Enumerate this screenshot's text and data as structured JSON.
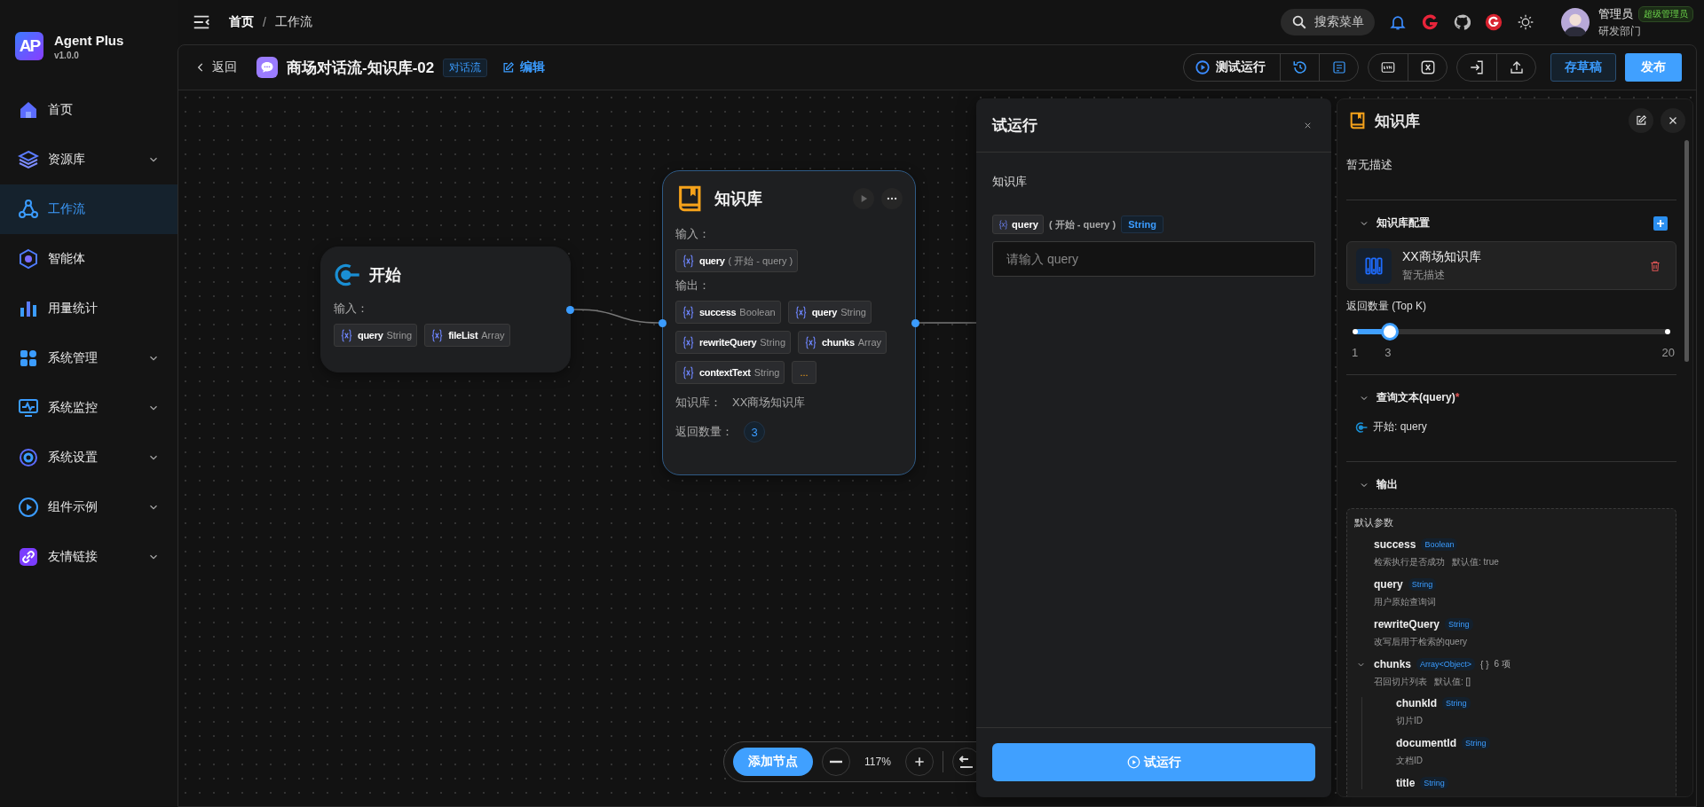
{
  "sidebar": {
    "logo_text": "AP",
    "brand": "Agent Plus",
    "version": "v1.0.0",
    "items": [
      {
        "label": "首页",
        "selected": false,
        "expandable": false
      },
      {
        "label": "资源库",
        "selected": false,
        "expandable": true
      },
      {
        "label": "工作流",
        "selected": true,
        "expandable": false
      },
      {
        "label": "智能体",
        "selected": false,
        "expandable": false
      },
      {
        "label": "用量统计",
        "selected": false,
        "expandable": false
      },
      {
        "label": "系统管理",
        "selected": false,
        "expandable": true
      },
      {
        "label": "系统监控",
        "selected": false,
        "expandable": true
      },
      {
        "label": "系统设置",
        "selected": false,
        "expandable": true
      },
      {
        "label": "组件示例",
        "selected": false,
        "expandable": true
      },
      {
        "label": "友情链接",
        "selected": false,
        "expandable": true
      }
    ]
  },
  "header": {
    "breadcrumb": [
      {
        "label": "首页",
        "current": false
      },
      {
        "label": "工作流",
        "current": true
      }
    ],
    "separator": "/",
    "search_label": "搜索菜单",
    "user": {
      "name": "管理员",
      "role": "超级管理员",
      "department": "研发部门"
    }
  },
  "toolbar": {
    "back": "返回",
    "title": "商场对话流-知识库-02",
    "tag": "对话流",
    "edit": "编辑",
    "test_run": "测试运行",
    "save_draft": "存草稿",
    "publish": "发布"
  },
  "canvas": {
    "nodes": [
      {
        "kind": "start",
        "title": "开始",
        "selected": false,
        "input_label": "输入：",
        "inputs": [
          {
            "name": "query",
            "type": "String"
          },
          {
            "name": "fileList",
            "type": "Array"
          }
        ]
      },
      {
        "kind": "knowledge",
        "title": "知识库",
        "selected": true,
        "input_label": "输入：",
        "inputs": [
          {
            "name": "query",
            "source": "( 开始 - query )"
          }
        ],
        "output_label": "输出：",
        "outputs": [
          {
            "name": "success",
            "type": "Boolean"
          },
          {
            "name": "query",
            "type": "String"
          },
          {
            "name": "rewriteQuery",
            "type": "String"
          },
          {
            "name": "chunks",
            "type": "Array"
          },
          {
            "name": "contextText",
            "type": "String"
          }
        ],
        "more": "...",
        "kb_label": "知识库：",
        "kb_value": "XX商场知识库",
        "topk_label": "返回数量：",
        "topk_value": "3"
      }
    ],
    "controls": {
      "add_node": "添加节点",
      "zoom": "117%"
    }
  },
  "test_panel": {
    "title": "试运行",
    "section": "知识库",
    "field": {
      "variable": "query",
      "source": "( 开始 - query )",
      "type": "String",
      "placeholder": "请输入 query"
    },
    "run": "试运行"
  },
  "node_panel": {
    "title": "知识库",
    "description": "暂无描述",
    "sections": [
      {
        "kind": "config",
        "title": "知识库配置",
        "expanded": true,
        "kb": {
          "name": "XX商场知识库",
          "description": "暂无描述"
        },
        "topk": {
          "label": "返回数量 (Top K)",
          "level": 0.105,
          "min": "1",
          "value": "3",
          "max": "20"
        }
      },
      {
        "kind": "query",
        "title": "查询文本(query)",
        "required_mark": "*",
        "expanded": true,
        "source": "开始: query"
      },
      {
        "kind": "output",
        "title": "输出",
        "expanded": true,
        "group_label": "默认参数",
        "params": [
          {
            "name": "success",
            "type": "Boolean",
            "description": "检索执行是否成功",
            "default": "默认值: true"
          },
          {
            "name": "query",
            "type": "String",
            "description": "用户原始查询词"
          },
          {
            "name": "rewriteQuery",
            "type": "String",
            "description": "改写后用于检索的query"
          },
          {
            "name": "chunks",
            "type": "Array<Object>",
            "brace": "{ }",
            "count": "6 项",
            "expanded": true,
            "description": "召回切片列表",
            "default": "默认值: []",
            "children": [
              {
                "name": "chunkId",
                "type": "String",
                "description": "切片ID"
              },
              {
                "name": "documentId",
                "type": "String",
                "description": "文档ID"
              },
              {
                "name": "title",
                "type": "String"
              }
            ]
          }
        ]
      }
    ]
  }
}
